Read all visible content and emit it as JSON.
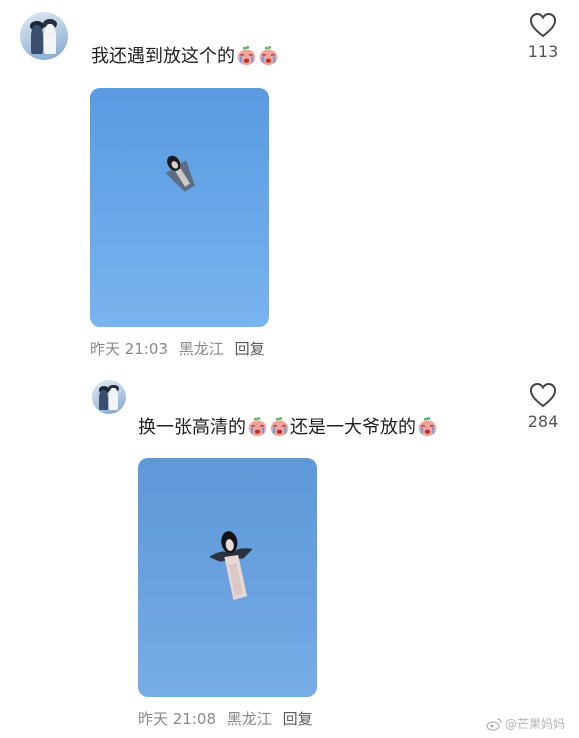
{
  "comments": [
    {
      "text": "我还遇到放这个的",
      "emoji_count": 2,
      "likes": "113",
      "time": "昨天 21:03",
      "location": "黑龙江",
      "reply_label": "回复"
    },
    {
      "text_before": "换一张高清的",
      "text_middle": "还是一大爷放的",
      "likes": "284",
      "time": "昨天 21:08",
      "location": "黑龙江",
      "reply_label": "回复"
    }
  ],
  "watermark": {
    "text": "@芒果妈妈"
  },
  "colors": {
    "sky": "#6aa8ea",
    "text": "#1f1f1f",
    "meta": "#8a8a8a"
  },
  "icons": [
    "heart-icon",
    "crying-emoji-icon",
    "weibo-icon"
  ]
}
